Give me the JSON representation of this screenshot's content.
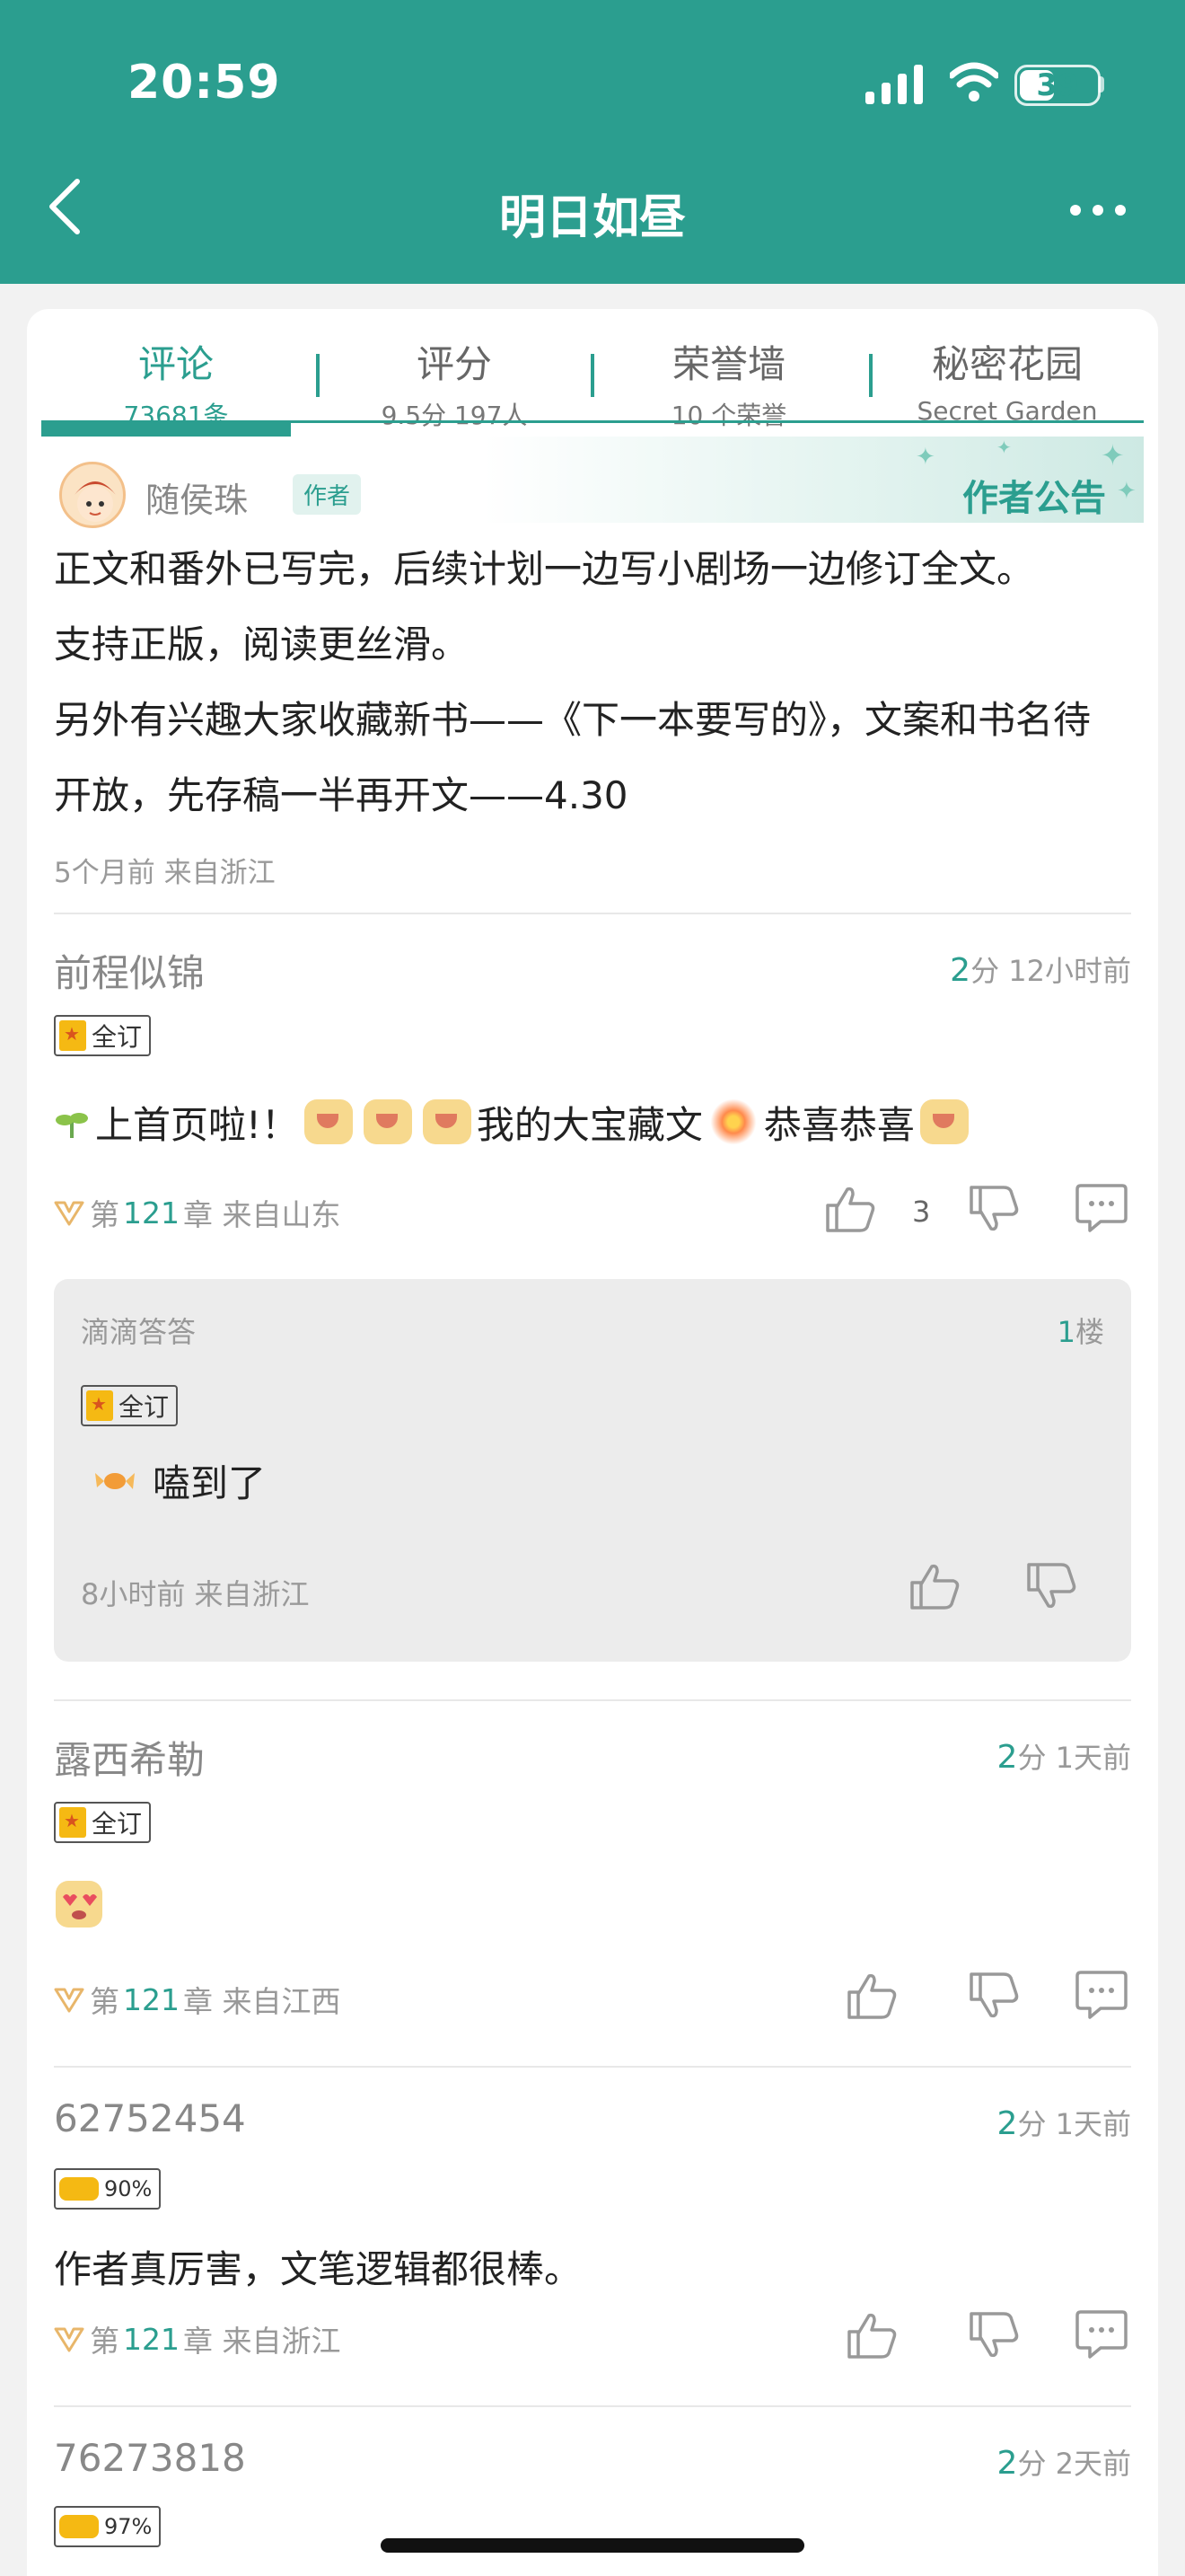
{
  "status": {
    "time": "20:59",
    "battery": "39"
  },
  "header": {
    "title": "明日如昼"
  },
  "tabs": [
    {
      "label": "评论",
      "sub": "73681条"
    },
    {
      "label": "评分",
      "sub": "9.5分 197人"
    },
    {
      "label": "荣誉墙",
      "sub": "10 个荣誉"
    },
    {
      "label": "秘密花园",
      "sub": "Secret Garden"
    }
  ],
  "announcement": {
    "author": "随侯珠",
    "author_badge": "作者",
    "label": "作者公告",
    "lines": [
      "正文和番外已写完，后续计划一边写小剧场一边修订全文。",
      "支持正版，阅读更丝滑。",
      "另外有兴趣大家收藏新书——《下一本要写的》，文案和书名待",
      "开放，先存稿一半再开文——4.30"
    ],
    "meta": "5个月前  来自浙江"
  },
  "comments": [
    {
      "user": "前程似锦",
      "score": "2",
      "score_unit": "分",
      "time": "12小时前",
      "badge": "全订",
      "text_a": "上首页啦!！",
      "text_b": "我的大宝藏文",
      "text_c": "恭喜恭喜",
      "chapter_pre": "第",
      "chapter": "121",
      "chapter_post": "章 来自山东",
      "likes": "3"
    },
    {
      "user": "露西希勒",
      "score": "2",
      "score_unit": "分",
      "time": "1天前",
      "badge": "全订",
      "chapter_pre": "第",
      "chapter": "121",
      "chapter_post": "章 来自江西"
    },
    {
      "user": "62752454",
      "score": "2",
      "score_unit": "分",
      "time": "1天前",
      "badge": "90%",
      "text": "作者真厉害，文笔逻辑都很棒。",
      "chapter_pre": "第",
      "chapter": "121",
      "chapter_post": "章 来自浙江"
    },
    {
      "user": "76273818",
      "score": "2",
      "score_unit": "分",
      "time": "2天前",
      "badge": "97%"
    }
  ],
  "reply": {
    "user": "滴滴答答",
    "floor": "1",
    "floor_unit": "楼",
    "badge": "全订",
    "text": "嗑到了",
    "meta": "8小时前  来自浙江"
  },
  "colors": {
    "accent": "#2b9e8f",
    "header_bg": "#2b9e8f"
  }
}
